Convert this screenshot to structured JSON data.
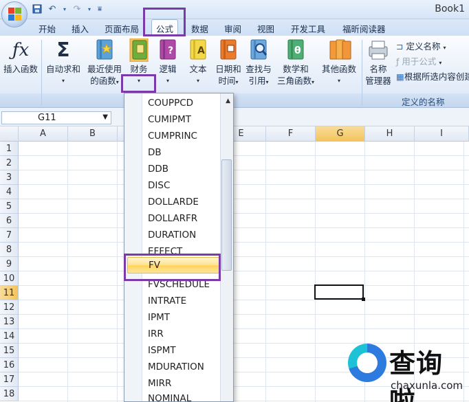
{
  "window": {
    "title": "Book1"
  },
  "tabs": [
    "开始",
    "插入",
    "页面布局",
    "公式",
    "数据",
    "审阅",
    "视图",
    "开发工具",
    "福昕阅读器"
  ],
  "active_tab": "公式",
  "ribbon": {
    "insert_function": {
      "label": "插入函数",
      "icon": "fx-icon"
    },
    "autosum": {
      "line1": "自动求和",
      "arrow": "▾"
    },
    "recent": {
      "line1": "最近使用",
      "line2": "的函数",
      "arrow": "▾"
    },
    "financial": {
      "line1": "财务",
      "arrow": "▾"
    },
    "logical": {
      "line1": "逻辑",
      "arrow": "▾"
    },
    "text": {
      "line1": "文本",
      "arrow": "▾"
    },
    "datetime": {
      "line1": "日期和",
      "line2": "时间",
      "arrow": "▾"
    },
    "lookup": {
      "line1": "查找与",
      "line2": "引用",
      "arrow": "▾"
    },
    "math": {
      "line1": "数学和",
      "line2": "三角函数",
      "arrow": "▾"
    },
    "more": {
      "line1": "其他函数",
      "arrow": "▾"
    },
    "name_manager": {
      "line1": "名称",
      "line2": "管理器"
    },
    "define_name": "定义名称",
    "use_in_formula": "用于公式",
    "create_from_selection": "根据所选内容创建",
    "group_defined_names": "定义的名称"
  },
  "formula_bar": {
    "name_box": "G11"
  },
  "columns": [
    "A",
    "B",
    "C",
    "D",
    "E",
    "F",
    "G",
    "H",
    "I"
  ],
  "selected_column": "G",
  "rows": [
    "1",
    "2",
    "3",
    "4",
    "5",
    "6",
    "7",
    "8",
    "9",
    "10",
    "11",
    "12",
    "13",
    "14",
    "15",
    "16",
    "17",
    "18"
  ],
  "selected_row": "11",
  "dropdown": {
    "items": [
      "COUPPCD",
      "CUMIPMT",
      "CUMPRINC",
      "DB",
      "DDB",
      "DISC",
      "DOLLARDE",
      "DOLLARFR",
      "DURATION",
      "EFFECT",
      "FV",
      "FVSCHEDULE",
      "INTRATE",
      "IPMT",
      "IRR",
      "ISPMT",
      "MDURATION",
      "MIRR",
      "NOMINAL"
    ],
    "highlighted": "FV"
  },
  "watermark": {
    "text": "查询啦",
    "url": "chaxunla.com"
  }
}
